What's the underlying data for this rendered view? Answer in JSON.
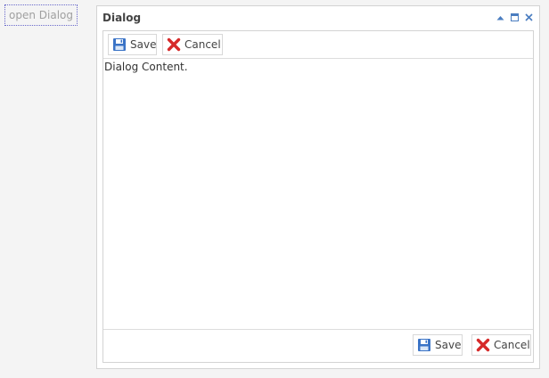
{
  "open_link": {
    "label": "open Dialog"
  },
  "dialog": {
    "title": "Dialog",
    "tools": [
      "collapse-icon",
      "maximize-icon",
      "close-icon"
    ],
    "toolbar": {
      "save_label": "Save",
      "cancel_label": "Cancel"
    },
    "content": "Dialog Content.",
    "footer": {
      "save_label": "Save",
      "cancel_label": "Cancel"
    }
  },
  "colors": {
    "save_icon": "#3a73c6",
    "cancel_icon": "#d62a2a",
    "tool_icon": "#4a7dc0",
    "link_border": "#6a6acb"
  }
}
